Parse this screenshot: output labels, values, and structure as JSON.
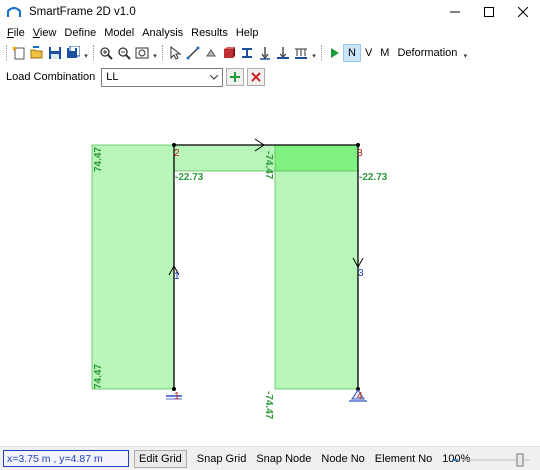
{
  "window": {
    "title": "SmartFrame 2D v1.0"
  },
  "menu": [
    {
      "label": "File",
      "key": "F"
    },
    {
      "label": "View",
      "key": "V"
    },
    {
      "label": "Define",
      "key": ""
    },
    {
      "label": "Model",
      "key": ""
    },
    {
      "label": "Analysis",
      "key": ""
    },
    {
      "label": "Results",
      "key": ""
    },
    {
      "label": "Help",
      "key": ""
    }
  ],
  "toolbar": {
    "n_label": "N",
    "v_label": "V",
    "m_label": "M",
    "deformation_label": "Deformation",
    "active": "N"
  },
  "load": {
    "label": "Load Combination",
    "selected": "LL"
  },
  "diagram": {
    "axial_values": {
      "left_col_top": "74.47",
      "left_col_bottom": "74.47",
      "right_col_top": "-74.47",
      "right_col_bottom": "-74.47",
      "beam_left": "-22.73",
      "beam_right": "-22.73"
    },
    "nodes": [
      "1",
      "2",
      "3",
      "4"
    ],
    "members": [
      "1",
      "3"
    ],
    "fill_color": "#b8f5b8",
    "fill_dark": "#80f080",
    "text_color": "#2e9a3a"
  },
  "status": {
    "coords": "x=3.75 m , y=4.87 m",
    "edit_grid": "Edit Grid",
    "snap_grid": "Snap Grid",
    "snap_node": "Snap Node",
    "node_no": "Node No",
    "element_no": "Element No",
    "zoom": "100%"
  }
}
